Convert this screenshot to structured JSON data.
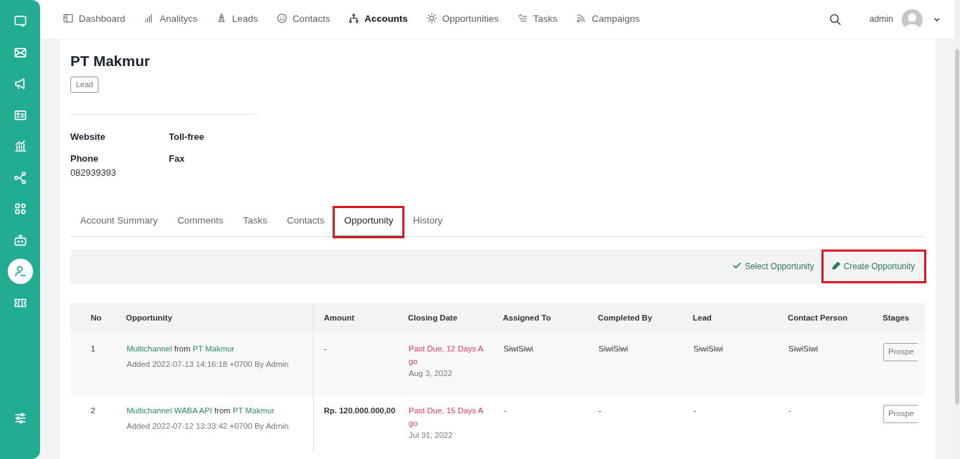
{
  "sidebar": {
    "items": [
      {
        "selected": false
      },
      {
        "selected": false
      },
      {
        "selected": false
      },
      {
        "selected": false
      },
      {
        "selected": false
      },
      {
        "selected": false
      },
      {
        "selected": false
      },
      {
        "selected": false
      },
      {
        "selected": true
      },
      {
        "selected": false
      }
    ]
  },
  "topnav": {
    "items": [
      {
        "label": "Dashboard",
        "selected": false
      },
      {
        "label": "Analitycs",
        "selected": false
      },
      {
        "label": "Leads",
        "selected": false
      },
      {
        "label": "Contacts",
        "selected": false
      },
      {
        "label": "Accounts",
        "selected": true
      },
      {
        "label": "Opportunities",
        "selected": false
      },
      {
        "label": "Tasks",
        "selected": false
      },
      {
        "label": "Campaigns",
        "selected": false
      }
    ],
    "user": "admin"
  },
  "account": {
    "name": "PT Makmur",
    "badge": "Lead",
    "fields": [
      {
        "label": "Website"
      },
      {
        "label": "Toll-free"
      },
      {
        "label": "Phone",
        "value": "082939393"
      },
      {
        "label": "Fax"
      }
    ]
  },
  "tabs": [
    {
      "label": "Account Summary",
      "selected": false,
      "highlighted": false
    },
    {
      "label": "Comments",
      "selected": false,
      "highlighted": false
    },
    {
      "label": "Tasks",
      "selected": false,
      "highlighted": false
    },
    {
      "label": "Contacts",
      "selected": false,
      "highlighted": false
    },
    {
      "label": "Opportunity",
      "selected": true,
      "highlighted": true
    },
    {
      "label": "History",
      "selected": false,
      "highlighted": false
    }
  ],
  "actions": [
    {
      "label": "Select Opportunity",
      "kind": "select",
      "highlighted": false
    },
    {
      "label": "Create Opportunity",
      "kind": "create",
      "highlighted": true
    }
  ],
  "table": {
    "columns": [
      "No",
      "Opportunity",
      "Amount",
      "Closing Date",
      "Assigned To",
      "Completed By",
      "Lead",
      "Contact Person",
      "Stages"
    ],
    "rows": [
      {
        "no": "1",
        "title_parts": [
          {
            "text": "Multichannel",
            "kind": "link"
          },
          {
            "text": " from ",
            "kind": "plain"
          },
          {
            "text": "PT Makmur",
            "kind": "link"
          }
        ],
        "added": "Added 2022-07-13 14:16:18 +0700 By Admin",
        "amount": "-",
        "due": "Past Due, 12 Days Ago",
        "date": "Aug 3, 2022",
        "assigned_to": "SiwiSiwi",
        "completed_by": "SiwiSiwi",
        "lead": "SiwiSiwi",
        "contact_person": "SiwiSiwi",
        "stage": "Prospe"
      },
      {
        "no": "2",
        "title_parts": [
          {
            "text": "Multichannel WABA API",
            "kind": "link"
          },
          {
            "text": " from ",
            "kind": "plain"
          },
          {
            "text": "PT Makmur",
            "kind": "link"
          }
        ],
        "added": "Added 2022-07-12 13:33:42 +0700 By Admin",
        "amount": "Rp. 120.000.000,00",
        "due": "Past Due, 15 Days Ago",
        "date": "Jul 31, 2022",
        "assigned_to": "-",
        "completed_by": "-",
        "lead": "-",
        "contact_person": "-",
        "stage": "Prospe"
      }
    ]
  }
}
